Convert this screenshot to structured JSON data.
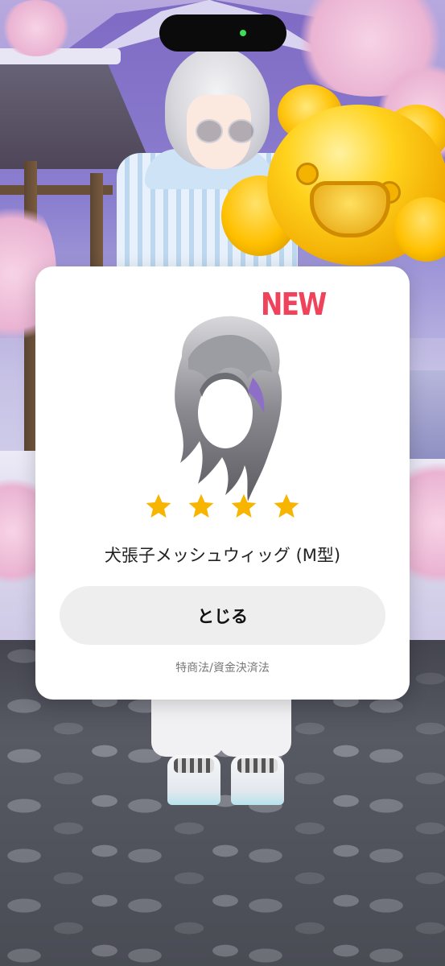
{
  "dialog": {
    "badge": "NEW",
    "item_name": "犬張子メッシュウィッグ (M型)",
    "rarity_stars": 4,
    "close_label": "とじる",
    "legal_link": "特商法/資金決済法"
  },
  "icons": {
    "star": "star-icon",
    "item": "wig-icon",
    "camera_indicator": "green-dot"
  },
  "colors": {
    "badge": "#f0435b",
    "star": "#f7b500",
    "button_bg": "#eeeeef",
    "camera_dot": "#3fdc57"
  }
}
